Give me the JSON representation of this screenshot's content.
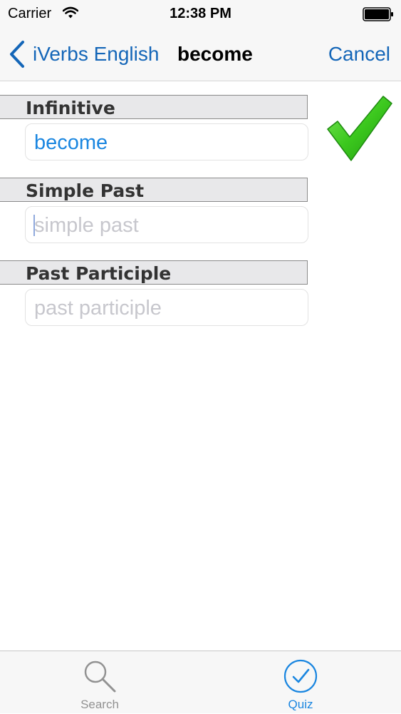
{
  "status_bar": {
    "carrier": "Carrier",
    "time": "12:38 PM"
  },
  "nav": {
    "back_label": "iVerbs English",
    "title": "become",
    "cancel_label": "Cancel"
  },
  "form": {
    "infinitive": {
      "label": "Infinitive",
      "value": "become",
      "placeholder": ""
    },
    "simple_past": {
      "label": "Simple Past",
      "value": "",
      "placeholder": "simple past"
    },
    "past_participle": {
      "label": "Past Participle",
      "value": "",
      "placeholder": "past participle"
    }
  },
  "result_icon": "checkmark-icon",
  "tabs": [
    {
      "label": "Search",
      "icon": "search-icon",
      "selected": false
    },
    {
      "label": "Quiz",
      "icon": "checkmark-circle-icon",
      "selected": true
    }
  ],
  "colors": {
    "accent": "#1a86e0",
    "nav_link": "#1466b8",
    "check_green": "#3cc81e"
  }
}
